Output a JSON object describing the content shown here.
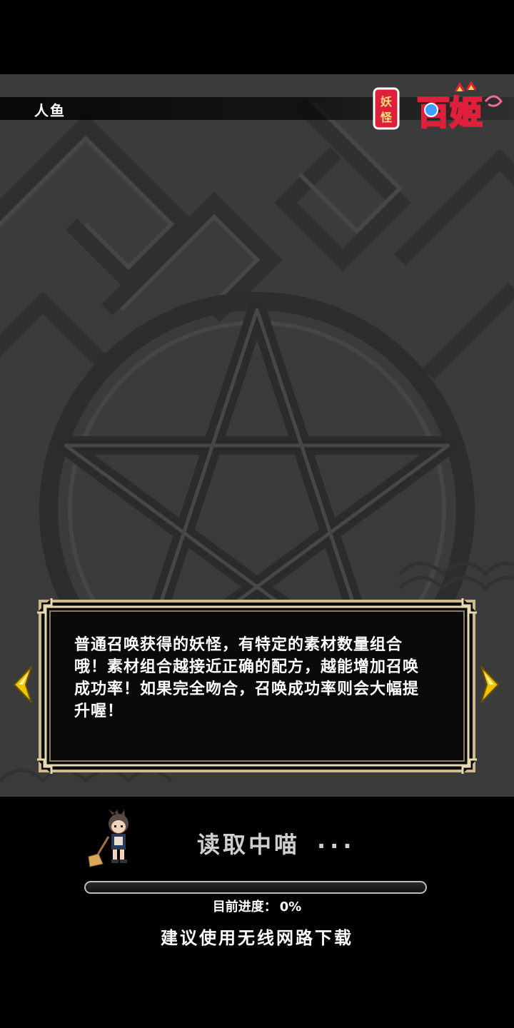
{
  "header": {
    "title": "人鱼",
    "logo_text": "妖怪百姬",
    "logo_small_text": "妖怪"
  },
  "tip": {
    "text": "普通召唤获得的妖怪，有特定的素材数量组合哦！素材组合越接近正确的配方，越能增加召唤成功率！如果完全吻合，召唤成功率则会大幅提升喔！"
  },
  "navigation": {
    "prev_icon": "chevron-left-icon",
    "next_icon": "chevron-right-icon"
  },
  "loading": {
    "status_text": "读取中喵",
    "dots": "...",
    "progress_label": "目前进度：",
    "progress_value": "0%",
    "progress_fraction": 0,
    "advice": "建议使用无线网路下载"
  },
  "colors": {
    "arrow": "#f2c300",
    "frame_gold": "#d8c79a",
    "background": "#3b3b3b",
    "logo_red": "#e0203a"
  }
}
